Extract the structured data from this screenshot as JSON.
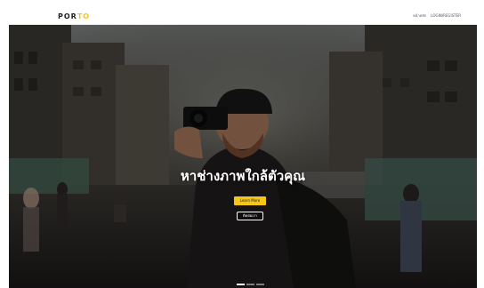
{
  "navbar": {
    "brand_part1": "POR",
    "brand_part2": "TO",
    "links": [
      {
        "label": "หน้าหลัก"
      },
      {
        "label": "LOGIN/REGISTER"
      }
    ]
  },
  "hero": {
    "headline": "หาช่างภาพใกล้ตัวคุณ",
    "primary_button": "Learn More",
    "secondary_button": "ติดต่อเรา",
    "carousel": {
      "slide_count": 3,
      "active_index": 0
    }
  },
  "colors": {
    "brand_accent": "#f2c230",
    "primary_button": "#f5c518"
  }
}
